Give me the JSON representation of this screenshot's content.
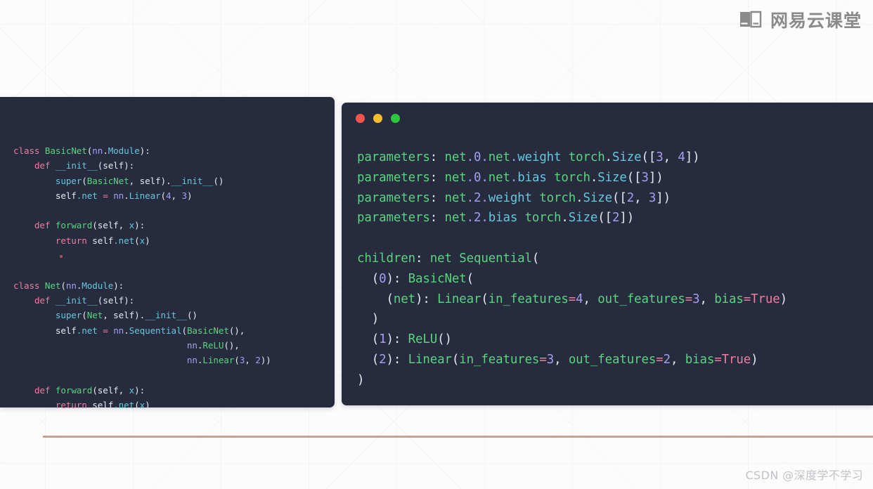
{
  "brand": {
    "icon": "book-card-icon",
    "text": "网易云课堂",
    "color": "#8a8a8a"
  },
  "watermark": {
    "text": "CSDN @深度学不学习"
  },
  "theme": {
    "page_background": "#fcfcfd",
    "panel_background": "#262b3d",
    "divider_color": "#c08f86",
    "keyword_color": "#f07ba0",
    "class_color": "#5ad47f",
    "module_color": "#a99cf0",
    "attribute_color": "#66c7dd",
    "plain_color": "#e8e8f0"
  },
  "panels": [
    {
      "id": "source-code-panel",
      "title_bar": {
        "dots": [
          "red",
          "yellow",
          "green"
        ]
      },
      "code_plain": "class BasicNet(nn.Module):\n    def __init__(self):\n        super(BasicNet, self).__init__()\n        self.net = nn.Linear(4, 3)\n\n    def forward(self, x):\n        return self.net(x)\n\n\nclass Net(nn.Module):\n    def __init__(self):\n        super(Net, self).__init__()\n        self.net = nn.Sequential(BasicNet(),\n                                 nn.ReLU(),\n                                 nn.Linear(3, 2))\n\n    def forward(self, x):\n        return self.net(x)",
      "lines": [
        "class BasicNet(nn.Module):",
        "    def __init__(self):",
        "        super(BasicNet, self).__init__()",
        "        self.net = nn.Linear(4, 3)",
        "",
        "    def forward(self, x):",
        "        return self.net(x)",
        "",
        "",
        "class Net(nn.Module):",
        "    def __init__(self):",
        "        super(Net, self).__init__()",
        "        self.net = nn.Sequential(BasicNet(),",
        "                                 nn.ReLU(),",
        "                                 nn.Linear(3, 2))",
        "",
        "    def forward(self, x):",
        "        return self.net(x)"
      ]
    },
    {
      "id": "output-console-panel",
      "title_bar": {
        "dots": [
          "red",
          "yellow",
          "green"
        ]
      },
      "code_plain": "parameters: net.0.net.weight torch.Size([3, 4])\nparameters: net.0.net.bias torch.Size([3])\nparameters: net.2.weight torch.Size([2, 3])\nparameters: net.2.bias torch.Size([2])\n\nchildren: net Sequential(\n  (0): BasicNet(\n    (net): Linear(in_features=4, out_features=3, bias=True)\n  )\n  (1): ReLU()\n  (2): Linear(in_features=3, out_features=2, bias=True)\n)",
      "lines": [
        "parameters: net.0.net.weight torch.Size([3, 4])",
        "parameters: net.0.net.bias torch.Size([3])",
        "parameters: net.2.weight torch.Size([2, 3])",
        "parameters: net.2.bias torch.Size([2])",
        "",
        "children: net Sequential(",
        "  (0): BasicNet(",
        "    (net): Linear(in_features=4, out_features=3, bias=True)",
        "  )",
        "  (1): ReLU()",
        "  (2): Linear(in_features=3, out_features=2, bias=True)",
        ")"
      ]
    }
  ]
}
